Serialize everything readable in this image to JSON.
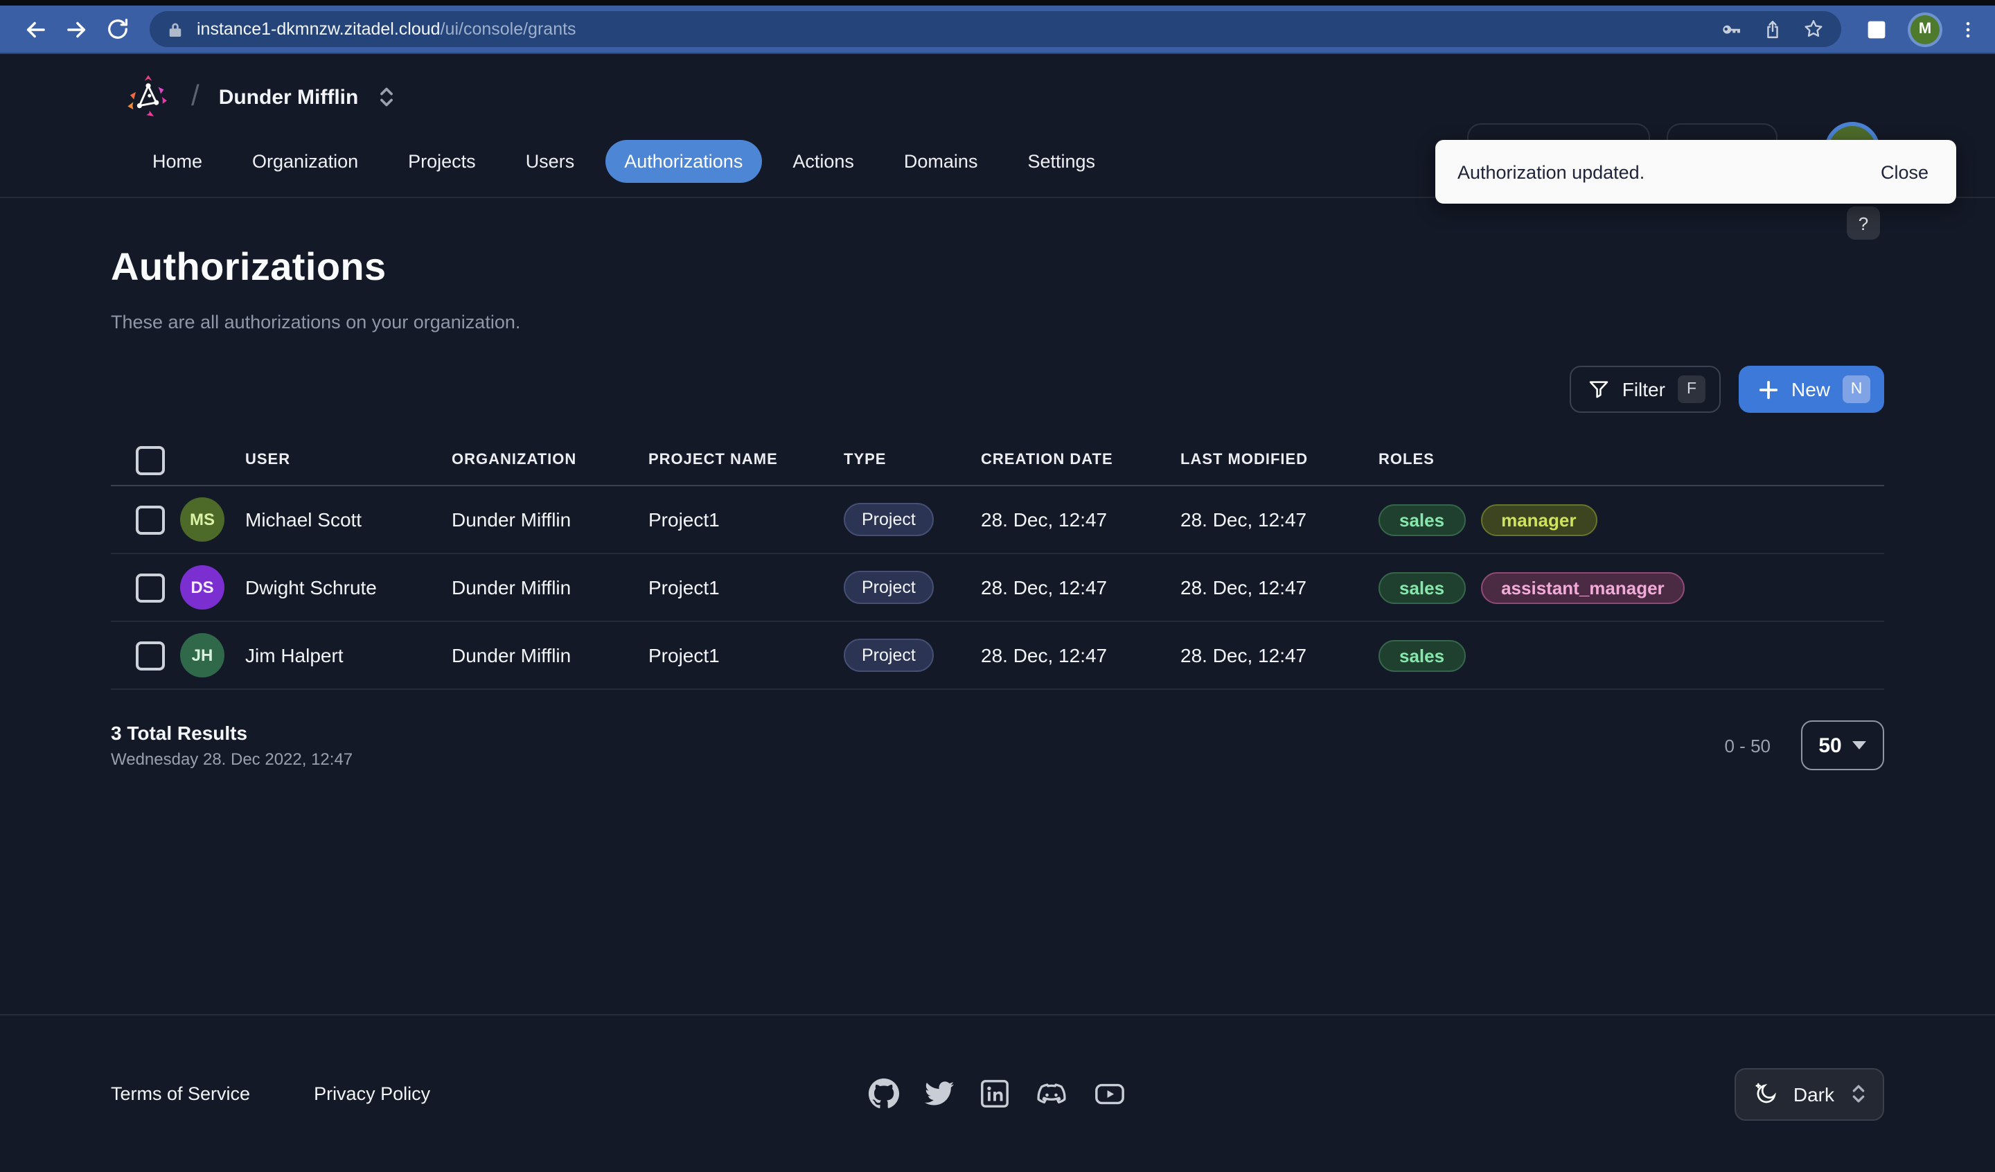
{
  "browser": {
    "url_host": "instance1-dkmnzw.zitadel.cloud",
    "url_path": "/ui/console/grants",
    "profile_initial": "M"
  },
  "header": {
    "org_name": "Dunder Mifflin",
    "help_label": "?",
    "nav": [
      {
        "label": "Home",
        "active": false
      },
      {
        "label": "Organization",
        "active": false
      },
      {
        "label": "Projects",
        "active": false
      },
      {
        "label": "Users",
        "active": false
      },
      {
        "label": "Authorizations",
        "active": true
      },
      {
        "label": "Actions",
        "active": false
      },
      {
        "label": "Domains",
        "active": false
      },
      {
        "label": "Settings",
        "active": false
      }
    ]
  },
  "toast": {
    "message": "Authorization updated.",
    "close_label": "Close"
  },
  "page": {
    "title": "Authorizations",
    "subtitle": "These are all authorizations on your organization.",
    "filter_label": "Filter",
    "filter_shortcut": "F",
    "new_label": "New",
    "new_shortcut": "N"
  },
  "table": {
    "columns": [
      "USER",
      "ORGANIZATION",
      "PROJECT NAME",
      "TYPE",
      "CREATION DATE",
      "LAST MODIFIED",
      "ROLES"
    ],
    "rows": [
      {
        "initials": "MS",
        "user": "Michael Scott",
        "organization": "Dunder Mifflin",
        "project": "Project1",
        "type": "Project",
        "created": "28. Dec, 12:47",
        "modified": "28. Dec, 12:47",
        "roles": [
          {
            "label": "sales",
            "variant": "green"
          },
          {
            "label": "manager",
            "variant": "olive"
          }
        ]
      },
      {
        "initials": "DS",
        "user": "Dwight Schrute",
        "organization": "Dunder Mifflin",
        "project": "Project1",
        "type": "Project",
        "created": "28. Dec, 12:47",
        "modified": "28. Dec, 12:47",
        "roles": [
          {
            "label": "sales",
            "variant": "green"
          },
          {
            "label": "assistant_manager",
            "variant": "pink"
          }
        ]
      },
      {
        "initials": "JH",
        "user": "Jim Halpert",
        "organization": "Dunder Mifflin",
        "project": "Project1",
        "type": "Project",
        "created": "28. Dec, 12:47",
        "modified": "28. Dec, 12:47",
        "roles": [
          {
            "label": "sales",
            "variant": "green"
          }
        ]
      }
    ],
    "total_label": "3 Total Results",
    "timestamp": "Wednesday 28. Dec 2022, 12:47",
    "range": "0 - 50",
    "page_size": "50"
  },
  "footer": {
    "links": [
      "Terms of Service",
      "Privacy Policy"
    ],
    "social_icons": [
      "github",
      "twitter",
      "linkedin",
      "discord",
      "youtube"
    ],
    "theme_label": "Dark"
  },
  "colors": {
    "page_bg": "#141927",
    "toolbar_blue": "#3a5fa4",
    "urlbar_blue": "#254479",
    "accent_blue": "#3c79d8",
    "nav_active_blue": "#4c86d4",
    "toast_bg": "#fafafa",
    "role_sales_text": "#86e6ac",
    "role_manager_text": "#cfe25d",
    "role_assistant_manager_text": "#f2abd8",
    "avatar_ms": "#4d6a28",
    "avatar_ds": "#7b2fd1",
    "avatar_jh": "#30684a",
    "type_chip_bg": "#2b3452"
  }
}
